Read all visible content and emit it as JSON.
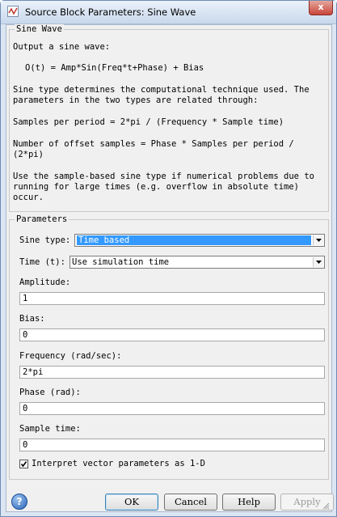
{
  "window": {
    "title": "Source Block Parameters: Sine Wave",
    "close_label": "x"
  },
  "description": {
    "group_title": "Sine Wave",
    "lines": [
      "Output a sine wave:",
      "O(t) = Amp*Sin(Freq*t+Phase) + Bias",
      "Sine type determines the computational technique used. The",
      "parameters in the two types are related through:",
      "Samples per period = 2*pi / (Frequency * Sample time)",
      "Number of offset samples = Phase * Samples per period /",
      "(2*pi)",
      "Use the sample-based sine type if numerical problems due to",
      "running for large times (e.g. overflow in absolute time)",
      "occur."
    ]
  },
  "parameters": {
    "group_title": "Parameters",
    "sine_type": {
      "label": "Sine type:",
      "value": "Time based"
    },
    "time": {
      "label": "Time (t):",
      "value": "Use simulation time"
    },
    "amplitude": {
      "label": "Amplitude:",
      "value": "1"
    },
    "bias": {
      "label": "Bias:",
      "value": "0"
    },
    "frequency": {
      "label": "Frequency (rad/sec):",
      "value": "2*pi"
    },
    "phase": {
      "label": "Phase (rad):",
      "value": "0"
    },
    "sample_time": {
      "label": "Sample time:",
      "value": "0"
    },
    "interpret_vector": {
      "label": "Interpret vector parameters as 1-D",
      "checked": true
    }
  },
  "buttons": {
    "help_icon": "?",
    "ok": "OK",
    "cancel": "Cancel",
    "help": "Help",
    "apply": "Apply"
  }
}
